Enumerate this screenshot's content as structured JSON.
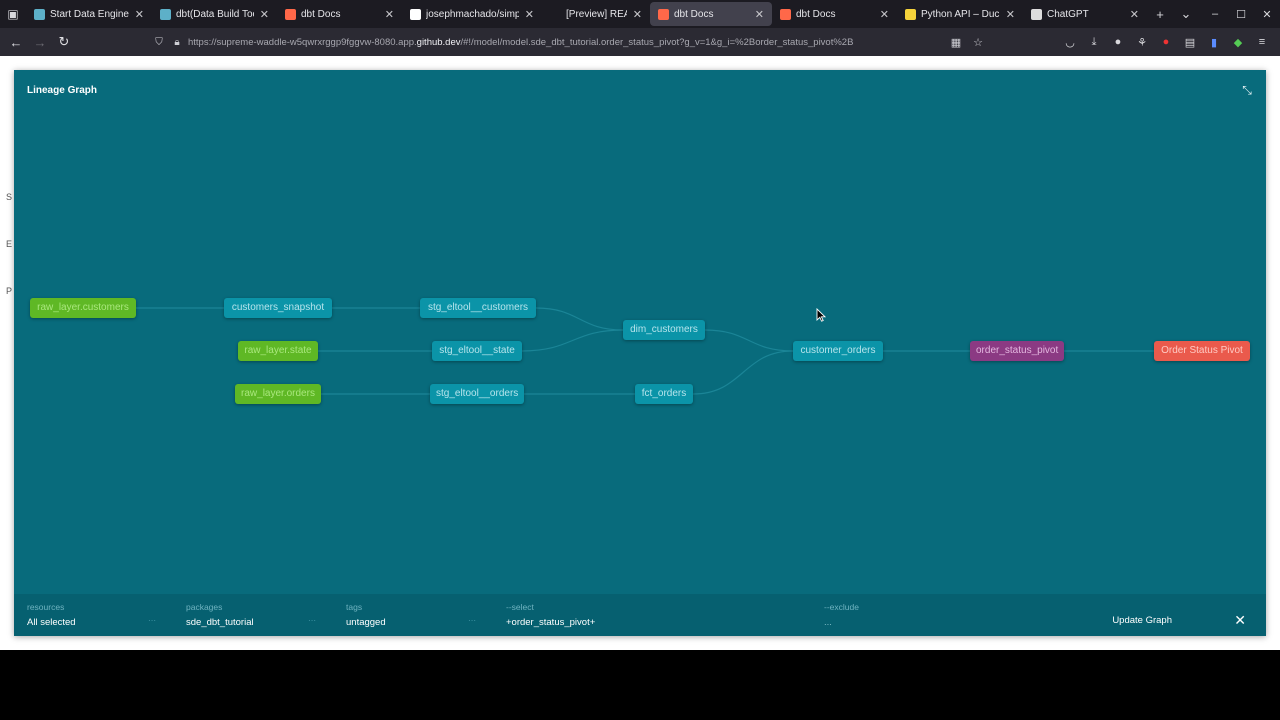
{
  "browser": {
    "tabs": [
      {
        "title": "Start Data Engineerin",
        "fav": "#5db0c8",
        "width": 126,
        "active": false
      },
      {
        "title": "dbt(Data Build Tool) l",
        "fav": "#5db0c8",
        "width": 125,
        "active": false
      },
      {
        "title": "dbt Docs",
        "fav": "#ff6849",
        "width": 125,
        "active": false
      },
      {
        "title": "josephmachado/simp",
        "fav": "#ffffff",
        "width": 140,
        "active": false
      },
      {
        "title": "[Preview] README.mc",
        "fav": "",
        "width": 108,
        "active": false
      },
      {
        "title": "dbt Docs",
        "fav": "#ff6849",
        "width": 122,
        "active": true
      },
      {
        "title": "dbt Docs",
        "fav": "#ff6849",
        "width": 125,
        "active": false
      },
      {
        "title": "Python API – DuckDB",
        "fav": "#f5d33b",
        "width": 126,
        "active": false
      },
      {
        "title": "ChatGPT",
        "fav": "#dddddd",
        "width": 124,
        "active": false
      }
    ],
    "url_prefix": "https://supreme-waddle-w5qwrxrggp9fggvw-8080.app.",
    "url_domain": "github.dev",
    "url_suffix": "/#!/model/model.sde_dbt_tutorial.order_status_pivot?g_v=1&g_i=%2Border_status_pivot%2B"
  },
  "page": {
    "side_letters": [
      "S",
      "E",
      "P"
    ]
  },
  "graph": {
    "title": "Lineage Graph",
    "nodes": [
      {
        "id": "raw_layer_customers",
        "label": "raw_layer.customers",
        "kind": "source"
      },
      {
        "id": "raw_layer_state",
        "label": "raw_layer.state",
        "kind": "source"
      },
      {
        "id": "raw_layer_orders",
        "label": "raw_layer.orders",
        "kind": "source"
      },
      {
        "id": "customers_snapshot",
        "label": "customers_snapshot",
        "kind": "model"
      },
      {
        "id": "stg_eltool_customers",
        "label": "stg_eltool__customers",
        "kind": "model"
      },
      {
        "id": "stg_eltool_state",
        "label": "stg_eltool__state",
        "kind": "model"
      },
      {
        "id": "stg_eltool_orders",
        "label": "stg_eltool__orders",
        "kind": "model"
      },
      {
        "id": "dim_customers",
        "label": "dim_customers",
        "kind": "model"
      },
      {
        "id": "fct_orders",
        "label": "fct_orders",
        "kind": "model"
      },
      {
        "id": "customer_orders",
        "label": "customer_orders",
        "kind": "model"
      },
      {
        "id": "order_status_pivot",
        "label": "order_status_pivot",
        "kind": "exposure"
      },
      {
        "id": "order_status_pivot_exposure",
        "label": "Order Status Pivot",
        "kind": "final"
      }
    ],
    "edges": [
      [
        "raw_layer_customers",
        "customers_snapshot"
      ],
      [
        "customers_snapshot",
        "stg_eltool_customers"
      ],
      [
        "raw_layer_state",
        "stg_eltool_state"
      ],
      [
        "raw_layer_orders",
        "stg_eltool_orders"
      ],
      [
        "stg_eltool_customers",
        "dim_customers"
      ],
      [
        "stg_eltool_state",
        "dim_customers"
      ],
      [
        "stg_eltool_orders",
        "fct_orders"
      ],
      [
        "dim_customers",
        "customer_orders"
      ],
      [
        "fct_orders",
        "customer_orders"
      ],
      [
        "customer_orders",
        "order_status_pivot"
      ],
      [
        "order_status_pivot",
        "order_status_pivot_exposure"
      ]
    ]
  },
  "filters": {
    "resources_label": "resources",
    "resources_value": "All selected",
    "packages_label": "packages",
    "packages_value": "sde_dbt_tutorial",
    "tags_label": "tags",
    "tags_value": "untagged",
    "select_label": "--select",
    "select_value": "+order_status_pivot+",
    "exclude_label": "--exclude",
    "exclude_value": "...",
    "update_label": "Update Graph"
  }
}
